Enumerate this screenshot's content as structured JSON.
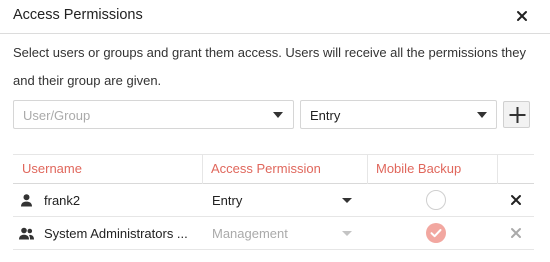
{
  "dialog": {
    "title": "Access Permissions",
    "description_line1": "Select users or groups and grant them access. Users will receive all the permissions they",
    "description_line2": "and their group are given."
  },
  "form": {
    "user_group_placeholder": "User/Group",
    "permission_value": "Entry"
  },
  "table": {
    "headers": {
      "username": "Username",
      "access_permission": "Access Permission",
      "mobile_backup": "Mobile Backup"
    },
    "rows": [
      {
        "username": "frank2",
        "permission": "Entry",
        "permission_enabled": true,
        "mobile_backup": false,
        "icon": "user-icon"
      },
      {
        "username": "System Administrators ...",
        "permission": "Management",
        "permission_enabled": false,
        "mobile_backup": true,
        "icon": "group-icon"
      }
    ]
  },
  "colors": {
    "accent": "#e0675c",
    "checked_fill": "#f2a7a0"
  }
}
